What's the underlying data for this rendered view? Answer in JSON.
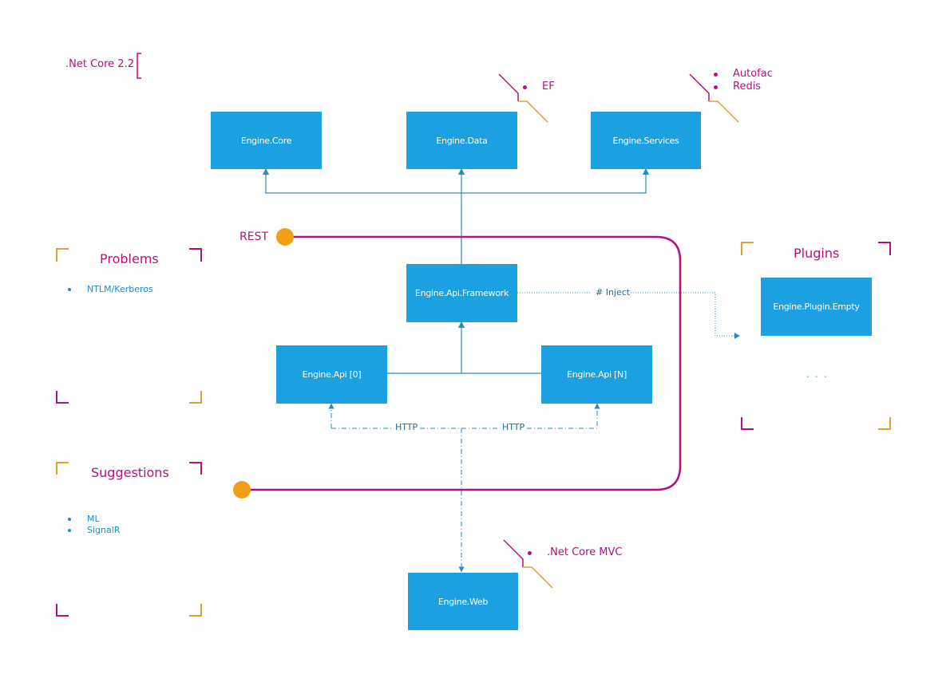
{
  "colors": {
    "box": "#1ba1e2",
    "connector": "#2a8bbf",
    "accent_magenta": "#b5117e",
    "accent_orange": "#f0a017",
    "bracket_orange": "#e0a030"
  },
  "framework_label": ".Net Core 2.2",
  "nodes": {
    "core": "Engine.Core",
    "data": "Engine.Data",
    "services": "Engine.Services",
    "api_framework": "Engine.Api.Framework",
    "api_0": "Engine.Api [0]",
    "api_n": "Engine.Api [N]",
    "web": "Engine.Web",
    "plugin_empty": "Engine.Plugin.Empty"
  },
  "annotations": {
    "data": [
      "EF"
    ],
    "services": [
      "Autofac",
      "Redis"
    ],
    "web": [
      ".Net Core MVC"
    ]
  },
  "edge_labels": {
    "inject": "# Inject",
    "http_left": "HTTP",
    "http_right": "HTTP",
    "rest": "REST"
  },
  "panels": {
    "problems": {
      "title": "Problems",
      "items": [
        "NTLM/Kerberos"
      ]
    },
    "suggestions": {
      "title": "Suggestions",
      "items": [
        "ML",
        "SignalR"
      ]
    },
    "plugins": {
      "title": "Plugins",
      "more": ". . ."
    }
  }
}
